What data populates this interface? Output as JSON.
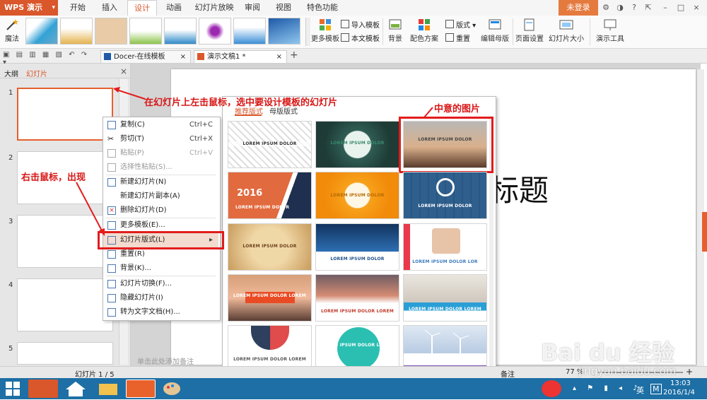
{
  "app": {
    "logo": "WPS 演示",
    "menu_tabs": [
      "开始",
      "插入",
      "设计",
      "动画",
      "幻灯片放映",
      "审阅",
      "视图",
      "特色功能"
    ],
    "active_tab": "设计",
    "login": "未登录"
  },
  "ribbon": {
    "magic": "魔法",
    "more_templates": "更多模板",
    "import_template": "导入模板",
    "body_template": "本文模板",
    "background": "背景",
    "color_scheme": "配色方案",
    "layout": "版式",
    "reset": "重置",
    "edit_master": "编辑母版",
    "page_setup": "页面设置",
    "slide_size": "幻灯片大小",
    "presentation_tools": "演示工具"
  },
  "doc_tabs": [
    {
      "label": "Docer-在线模板",
      "close": "×"
    },
    {
      "label": "演示文稿1 *",
      "close": "×"
    }
  ],
  "left_pane": {
    "tab_outline": "大纲",
    "tab_slides": "幻灯片",
    "close": "×",
    "slide_numbers": [
      "1",
      "2",
      "3",
      "4",
      "5"
    ]
  },
  "gallery": {
    "tab_recommended": "推荐版式",
    "tab_master": "母版版式",
    "thumb_labels": [
      "LOREM IPSUM DOLOR",
      "LOREM IPSUM DOLOR",
      "LOREM IPSUM DOLOR",
      "LOREM IPSUM DOLOR",
      "LOREM IPSUM DOLOR",
      "LOREM IPSUM DOLOR",
      "LOREM IPSUM DOLOR",
      "LOREM IPSUM DOLOR",
      "LOREM IPSUM DOLOR LOR",
      "LOREM IPSUM DOLOR LOREM",
      "LOREM IPSUM DOLOR LOREM",
      "LOREM IPSUM DOLOR LOREM",
      "LOREM IPSUM DOLOR LOREM",
      "LOREM IPSUM DOLOR LOREM",
      ""
    ],
    "year_label": "2016"
  },
  "context_menu": {
    "items": [
      {
        "label": "复制(C)",
        "shortcut": "Ctrl+C"
      },
      {
        "label": "剪切(T)",
        "shortcut": "Ctrl+X"
      },
      {
        "label": "粘贴(P)",
        "shortcut": "Ctrl+V"
      },
      {
        "label": "选择性粘贴(S)...",
        "shortcut": ""
      },
      {
        "label": "新建幻灯片(N)",
        "shortcut": ""
      },
      {
        "label": "新建幻灯片副本(A)",
        "shortcut": ""
      },
      {
        "label": "删除幻灯片(D)",
        "shortcut": ""
      },
      {
        "label": "更多模板(E)...",
        "shortcut": ""
      },
      {
        "label": "幻灯片版式(L)",
        "shortcut": ""
      },
      {
        "label": "重置(R)",
        "shortcut": ""
      },
      {
        "label": "背景(K)...",
        "shortcut": ""
      },
      {
        "label": "幻灯片切换(F)...",
        "shortcut": ""
      },
      {
        "label": "隐藏幻灯片(I)",
        "shortcut": ""
      },
      {
        "label": "转为文字文档(H)...",
        "shortcut": ""
      }
    ],
    "submenu_arrow": "▸"
  },
  "slide": {
    "title_fragment": "标题"
  },
  "annotations": {
    "top": "在幻灯片上左击鼠标，选中要设计模板的幻灯片",
    "left": "右击鼠标，出现",
    "right": "中意的图片"
  },
  "status": {
    "slide_count": "幻灯片 1 / 5",
    "notes_hint": "单击此处添加备注",
    "notes": "备注",
    "zoom": "77 %"
  },
  "taskbar": {
    "time": "13:03",
    "date": "2016/1/4",
    "ime": "英",
    "ime_mode": "M"
  },
  "watermark": {
    "text": "Bai du 经验",
    "url": "jingyan.baidu.com"
  },
  "colors": {
    "accent": "#d9572b",
    "annotation_red": "#e21c1c",
    "taskbar": "#1d6fa5"
  }
}
